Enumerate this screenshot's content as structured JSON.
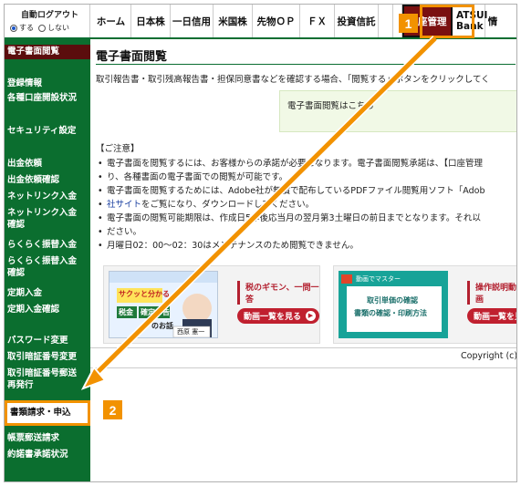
{
  "auto_logout": {
    "title": "自動ログアウト",
    "opt_on": "する",
    "opt_off": "しない",
    "selected": "する"
  },
  "tabs": [
    "ホーム",
    "日本株",
    "一日信用",
    "米国株",
    "先物ＯＰ",
    "ＦＸ",
    "投資信託",
    "",
    "",
    "口座管理",
    "ATSUI",
    "Bank",
    "情"
  ],
  "sidebar": {
    "items": [
      "電子書面閲覧",
      "登録情報",
      "各種口座開設状況",
      "セキュリティ設定",
      "出金依頼",
      "出金依頼確認",
      "ネットリンク入金",
      "ネットリンク入金",
      "確認",
      "らくらく振替入金",
      "らくらく振替入金",
      "確認",
      "定期入金",
      "定期入金確認",
      "パスワード変更",
      "取引暗証番号変更",
      "取引暗証番号郵送",
      "再発行",
      "書類請求・申込",
      "帳票郵送請求",
      "約諾書承諾状況"
    ]
  },
  "main": {
    "title": "電子書面閲覧",
    "lead": "取引報告書・取引残高報告書・担保同意書などを確認する場合、「閲覧する」ボタンをクリックしてく",
    "viewbox_text": "電子書面閲覧はこちら",
    "notes_heading": "【ご注意】",
    "notes": [
      "電子書面を閲覧するには、お客様からの承諾が必要となります。電子書面閲覧承諾は、【口座管理",
      "り、各種書面の電子書面での閲覧が可能です。",
      "電子書面を閲覧するためには、Adobe社が無償で配布しているPDFファイル閲覧用ソフト「Adob",
      "社サイトをご覧になり、ダウンロードしてください。",
      "電子書面の閲覧可能期限は、作成日5年後応当月の翌月第3土曜日の前日までとなります。それ以",
      "ださい。",
      "月曜日02：00～02：30はメンテナンスのため閲覧できません。"
    ],
    "notes_link": "社サイト",
    "banner1": {
      "label": "税のギモン、一問一答",
      "button": "動画一覧を見る",
      "thumb_text1": "サクッと分かる",
      "thumb_text2": "税金",
      "thumb_text3": "確定申告",
      "thumb_text4": "のお話",
      "thumb_name": "西原 憲一"
    },
    "banner2": {
      "label": "操作説明動画",
      "button": "動画一覧を見る",
      "thumb_head": "動画でマスター",
      "thumb_line1": "取引単価の確認",
      "thumb_line2": "書類の確認・印刷方法"
    },
    "copyright": "Copyright (c)"
  },
  "annotations": {
    "step1": "1",
    "step2": "2"
  },
  "colors": {
    "sidebar": "#0b6e2f",
    "active_tab": "#7a1010",
    "annotation": "#f29200"
  }
}
